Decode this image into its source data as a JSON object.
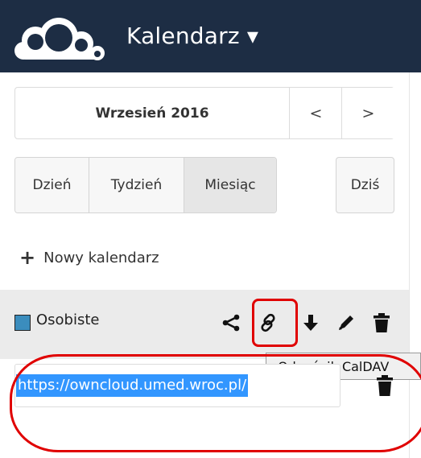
{
  "header": {
    "app_title": "Kalendarz ▾",
    "logo": "owncloud-logo-icon",
    "background_color": "#1d2d44"
  },
  "datepicker": {
    "month_label": "Wrzesień 2016",
    "prev_label": "<",
    "next_label": ">"
  },
  "views": {
    "day": "Dzień",
    "week": "Tydzień",
    "month": "Miesiąc",
    "active": "Miesiąc",
    "today": "Dziś"
  },
  "new_calendar": {
    "plus": "+",
    "label": "Nowy kalendarz"
  },
  "calendar": {
    "name": "Osobiste",
    "color": "#3b8dbd",
    "actions": [
      "share-icon",
      "link-icon",
      "download-icon",
      "edit-icon",
      "delete-icon"
    ]
  },
  "tooltip": {
    "text": "Odnośnik CalDAV"
  },
  "caldav_url": {
    "value": "https://owncloud.umed.wroc.pl/"
  },
  "annotation": {
    "color": "#e00000"
  }
}
